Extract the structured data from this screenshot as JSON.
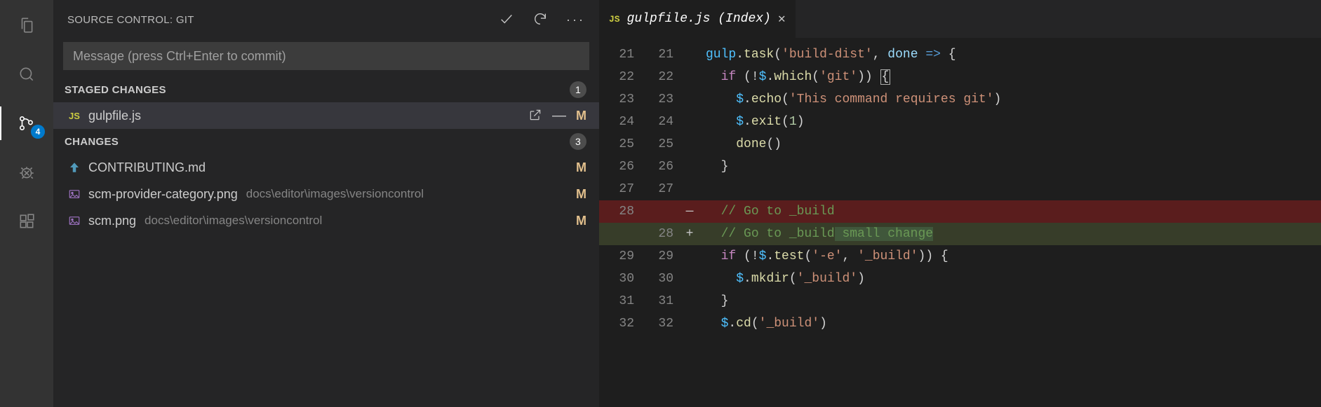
{
  "activity": {
    "scm_badge": "4"
  },
  "sidebar": {
    "title": "SOURCE CONTROL: GIT",
    "commit_placeholder": "Message (press Ctrl+Enter to commit)",
    "staged": {
      "label": "STAGED CHANGES",
      "count": "1",
      "items": [
        {
          "icon": "JS",
          "name": "gulpfile.js",
          "path": "",
          "status": "M",
          "selected": true,
          "hover_actions": true
        }
      ]
    },
    "changes": {
      "label": "CHANGES",
      "count": "3",
      "items": [
        {
          "icon": "md",
          "name": "CONTRIBUTING.md",
          "path": "",
          "status": "M"
        },
        {
          "icon": "img",
          "name": "scm-provider-category.png",
          "path": "docs\\editor\\images\\versioncontrol",
          "status": "M"
        },
        {
          "icon": "img",
          "name": "scm.png",
          "path": "docs\\editor\\images\\versioncontrol",
          "status": "M"
        }
      ]
    }
  },
  "editor": {
    "tab": {
      "icon": "JS",
      "label": "gulpfile.js (Index)"
    },
    "lines": [
      {
        "l": "21",
        "r": "21",
        "m": "",
        "seg": [
          [
            "obj",
            "gulp"
          ],
          [
            "pun",
            "."
          ],
          [
            "fn",
            "task"
          ],
          [
            "pun",
            "("
          ],
          [
            "str",
            "'build-dist'"
          ],
          [
            "pun",
            ", "
          ],
          [
            "var",
            "done"
          ],
          [
            "pun",
            " "
          ],
          [
            "arr",
            "=>"
          ],
          [
            "pun",
            " {"
          ]
        ]
      },
      {
        "l": "22",
        "r": "22",
        "m": "",
        "indent": 1,
        "seg": [
          [
            "kw",
            "if"
          ],
          [
            "pun",
            " (!"
          ],
          [
            "obj",
            "$"
          ],
          [
            "pun",
            "."
          ],
          [
            "fn",
            "which"
          ],
          [
            "pun",
            "("
          ],
          [
            "str",
            "'git'"
          ],
          [
            "pun",
            ")) "
          ],
          [
            "box",
            "{"
          ]
        ]
      },
      {
        "l": "23",
        "r": "23",
        "m": "",
        "indent": 2,
        "seg": [
          [
            "obj",
            "$"
          ],
          [
            "pun",
            "."
          ],
          [
            "fn",
            "echo"
          ],
          [
            "pun",
            "("
          ],
          [
            "str",
            "'This command requires git'"
          ],
          [
            "pun",
            ")"
          ]
        ]
      },
      {
        "l": "24",
        "r": "24",
        "m": "",
        "indent": 2,
        "seg": [
          [
            "obj",
            "$"
          ],
          [
            "pun",
            "."
          ],
          [
            "fn",
            "exit"
          ],
          [
            "pun",
            "("
          ],
          [
            "num",
            "1"
          ],
          [
            "pun",
            ")"
          ]
        ]
      },
      {
        "l": "25",
        "r": "25",
        "m": "",
        "indent": 2,
        "seg": [
          [
            "fn",
            "done"
          ],
          [
            "pun",
            "()"
          ]
        ]
      },
      {
        "l": "26",
        "r": "26",
        "m": "",
        "indent": 1,
        "seg": [
          [
            "pun",
            "}"
          ]
        ]
      },
      {
        "l": "27",
        "r": "27",
        "m": "",
        "seg": []
      },
      {
        "l": "28",
        "r": "",
        "m": "—",
        "type": "del",
        "indent": 1,
        "seg": [
          [
            "cmt",
            "// Go to _build"
          ]
        ]
      },
      {
        "l": "",
        "r": "28",
        "m": "+",
        "type": "add",
        "indent": 1,
        "seg": [
          [
            "cmt",
            "// Go to _build"
          ],
          [
            "hl",
            " small change"
          ]
        ]
      },
      {
        "l": "29",
        "r": "29",
        "m": "",
        "indent": 1,
        "seg": [
          [
            "kw",
            "if"
          ],
          [
            "pun",
            " (!"
          ],
          [
            "obj",
            "$"
          ],
          [
            "pun",
            "."
          ],
          [
            "fn",
            "test"
          ],
          [
            "pun",
            "("
          ],
          [
            "str",
            "'-e'"
          ],
          [
            "pun",
            ", "
          ],
          [
            "str",
            "'_build'"
          ],
          [
            "pun",
            ")) {"
          ]
        ]
      },
      {
        "l": "30",
        "r": "30",
        "m": "",
        "indent": 2,
        "seg": [
          [
            "obj",
            "$"
          ],
          [
            "pun",
            "."
          ],
          [
            "fn",
            "mkdir"
          ],
          [
            "pun",
            "("
          ],
          [
            "str",
            "'_build'"
          ],
          [
            "pun",
            ")"
          ]
        ]
      },
      {
        "l": "31",
        "r": "31",
        "m": "",
        "indent": 1,
        "seg": [
          [
            "pun",
            "}"
          ]
        ]
      },
      {
        "l": "32",
        "r": "32",
        "m": "",
        "indent": 1,
        "seg": [
          [
            "obj",
            "$"
          ],
          [
            "pun",
            "."
          ],
          [
            "fn",
            "cd"
          ],
          [
            "pun",
            "("
          ],
          [
            "str",
            "'_build'"
          ],
          [
            "pun",
            ")"
          ]
        ]
      }
    ]
  }
}
